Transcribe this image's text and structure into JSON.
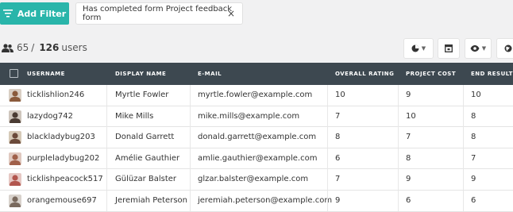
{
  "toolbar": {
    "add_filter_label": "Add Filter",
    "filter_chip_label": "Has completed form Project feedback form",
    "filter_chip_close": "×"
  },
  "summary": {
    "shown": "65",
    "separator": "/",
    "total": "126",
    "unit": "users"
  },
  "columns": [
    "USERNAME",
    "DISPLAY NAME",
    "E-MAIL",
    "OVERALL RATING",
    "PROJECT COST",
    "END RESULT"
  ],
  "rows": [
    {
      "username": "ticklishlion246",
      "display_name": "Myrtle Fowler",
      "email": "myrtle.fowler@example.com",
      "overall_rating": "10",
      "project_cost": "9",
      "end_result": "10",
      "avatar_color": "#8a5a3b"
    },
    {
      "username": "lazydog742",
      "display_name": "Mike Mills",
      "email": "mike.mills@example.com",
      "overall_rating": "7",
      "project_cost": "10",
      "end_result": "8",
      "avatar_color": "#4a3b33"
    },
    {
      "username": "blackladybug203",
      "display_name": "Donald Garrett",
      "email": "donald.garrett@example.com",
      "overall_rating": "8",
      "project_cost": "7",
      "end_result": "8",
      "avatar_color": "#6b4a3a"
    },
    {
      "username": "purpleladybug202",
      "display_name": "Amélie Gauthier",
      "email": "amlie.gauthier@example.com",
      "overall_rating": "6",
      "project_cost": "8",
      "end_result": "7",
      "avatar_color": "#a0604a"
    },
    {
      "username": "ticklishpeacock517",
      "display_name": "Gülüzar Balster",
      "email": "glzar.balster@example.com",
      "overall_rating": "7",
      "project_cost": "9",
      "end_result": "9",
      "avatar_color": "#b2564e"
    },
    {
      "username": "orangemouse697",
      "display_name": "Jeremiah Peterson",
      "email": "jeremiah.peterson@example.com",
      "overall_rating": "9",
      "project_cost": "6",
      "end_result": "6",
      "avatar_color": "#7a6a5e"
    }
  ],
  "colors": {
    "accent": "#29b5aa",
    "header_bg": "#3d4850",
    "page_bg": "#f1f1f2"
  },
  "icons": {
    "add_filter": "filter-lines-icon",
    "users": "users-icon",
    "chart": "pie-chart-icon",
    "export": "export-box-icon",
    "view": "eye-icon",
    "globe": "globe-icon"
  }
}
